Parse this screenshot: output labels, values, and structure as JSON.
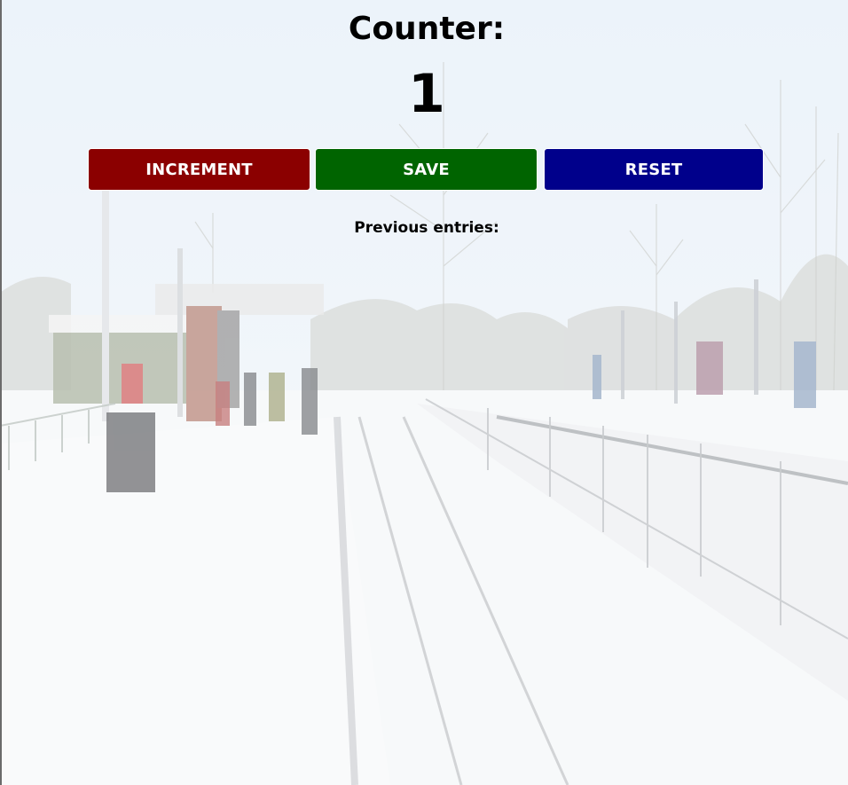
{
  "counter": {
    "title": "Counter:",
    "value": "1"
  },
  "buttons": {
    "increment": "INCREMENT",
    "save": "SAVE",
    "reset": "RESET"
  },
  "history": {
    "label": "Previous entries:",
    "entries": []
  },
  "colors": {
    "increment": "#8b0000",
    "save": "#006400",
    "reset": "#00008b"
  }
}
